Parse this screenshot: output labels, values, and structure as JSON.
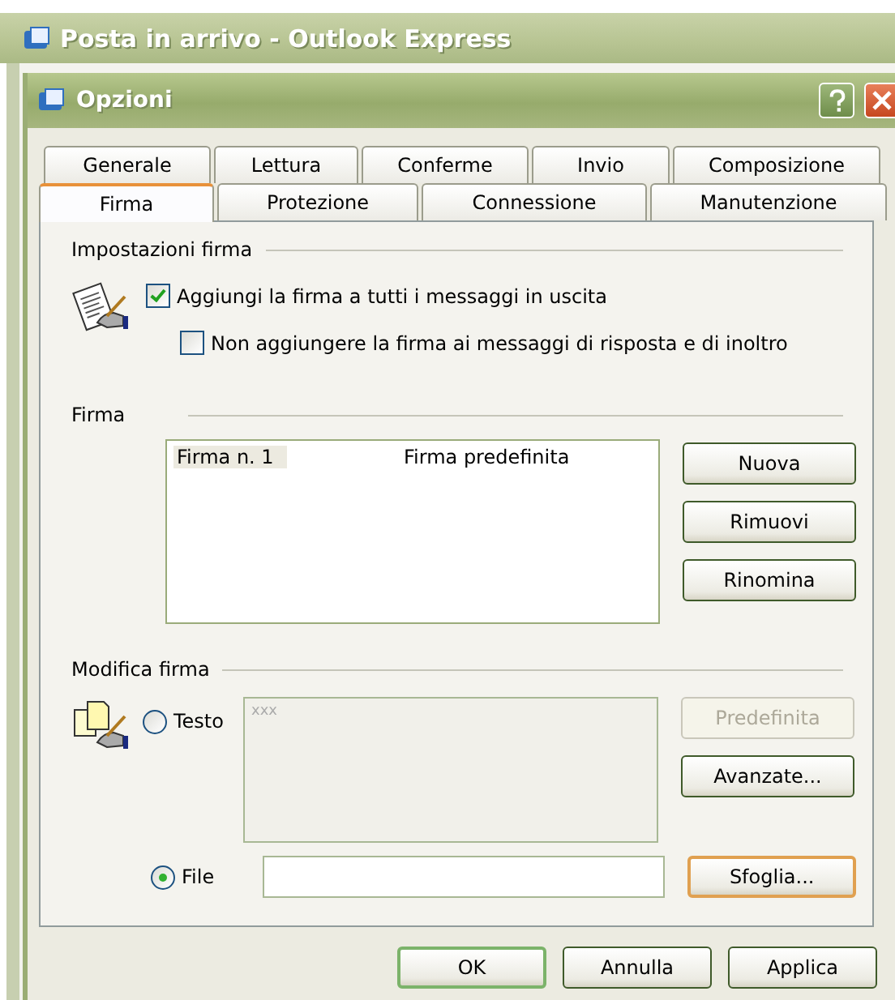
{
  "outer_window": {
    "title": "Posta in arrivo - Outlook Express"
  },
  "dialog": {
    "title": "Opzioni"
  },
  "tab_rows": [
    [
      {
        "label": "Generale",
        "selected": false
      },
      {
        "label": "Lettura",
        "selected": false
      },
      {
        "label": "Conferme",
        "selected": false
      },
      {
        "label": "Invio",
        "selected": false
      },
      {
        "label": "Composizione",
        "selected": false
      }
    ],
    [
      {
        "label": "Firma",
        "selected": true
      },
      {
        "label": "Protezione",
        "selected": false
      },
      {
        "label": "Connessione",
        "selected": false
      },
      {
        "label": "Manutenzione",
        "selected": false
      }
    ]
  ],
  "signature_settings": {
    "heading": "Impostazioni firma",
    "options": [
      {
        "label": "Aggiungi la firma a tutti i messaggi in uscita",
        "checked": true
      },
      {
        "label": "Non aggiungere la firma ai messaggi di risposta e di inoltro",
        "checked": false
      }
    ]
  },
  "signatures": {
    "heading": "Firma",
    "items": [
      {
        "name": "Firma n. 1",
        "note": "Firma predefinita",
        "selected": true
      }
    ],
    "buttons": [
      {
        "label": "Nuova"
      },
      {
        "label": "Rimuovi"
      },
      {
        "label": "Rinomina"
      }
    ]
  },
  "edit_signature": {
    "heading": "Modifica firma",
    "text_option": {
      "label": "Testo",
      "selected": false
    },
    "text_value": "xxx",
    "text_disabled": true,
    "side_buttons": [
      {
        "label": "Predefinita",
        "disabled": true
      },
      {
        "label": "Avanzate...",
        "disabled": false
      }
    ],
    "file_option": {
      "label": "File",
      "selected": true
    },
    "browse_button": {
      "label": "Sfoglia...",
      "highlighted": true
    }
  },
  "footer_buttons": [
    {
      "label": "OK",
      "default": true
    },
    {
      "label": "Annulla",
      "default": false
    },
    {
      "label": "Applica",
      "default": false
    }
  ]
}
